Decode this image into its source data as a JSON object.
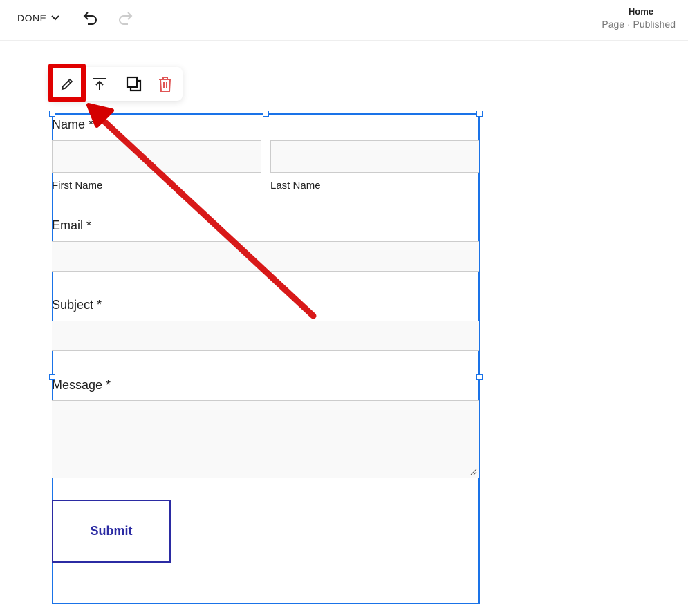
{
  "header": {
    "done_label": "DONE",
    "page_title": "Home",
    "page_status": "Page · Published"
  },
  "toolbar": {
    "edit": "edit",
    "move": "move-to-top",
    "duplicate": "duplicate",
    "delete": "delete"
  },
  "form": {
    "name_label": "Name *",
    "first_name_label": "First Name",
    "last_name_label": "Last Name",
    "email_label": "Email *",
    "subject_label": "Subject *",
    "message_label": "Message *",
    "submit_label": "Submit"
  },
  "colors": {
    "selection": "#1a73e8",
    "highlight": "#e00000",
    "submit": "#2b2ba3",
    "delete": "#e05555"
  }
}
